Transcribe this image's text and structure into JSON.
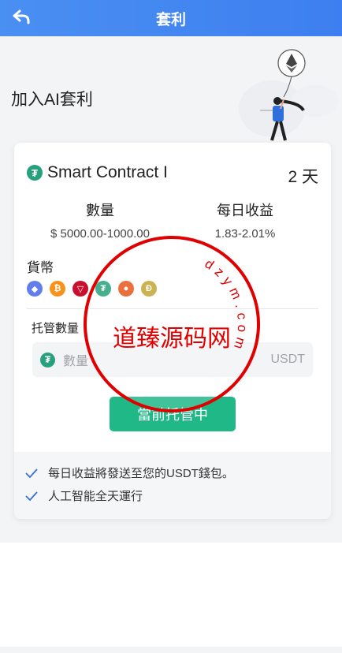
{
  "header": {
    "title": "套利",
    "back_icon": "back-arrow-icon"
  },
  "page": {
    "heading": "加入AI套利"
  },
  "card": {
    "coin_icon": "tether-icon",
    "contract_name": "Smart Contract I",
    "duration": "2 天",
    "stats": [
      {
        "label": "數量",
        "value": "$ 5000.00-1000.00"
      },
      {
        "label": "每日收益",
        "value": "1.83-2.01%"
      }
    ],
    "currency_label": "貨幣",
    "coins": [
      {
        "name": "ethereum-icon",
        "color": "#627eea",
        "glyph": "◆"
      },
      {
        "name": "bitcoin-icon",
        "color": "#f7931a",
        "glyph": "₿"
      },
      {
        "name": "tron-icon",
        "color": "#c8102e",
        "glyph": "▽"
      },
      {
        "name": "tether-icon",
        "color": "#26a17b",
        "glyph": "₮"
      },
      {
        "name": "shiba-icon",
        "color": "#e8581f",
        "glyph": "●"
      },
      {
        "name": "dogecoin-icon",
        "color": "#c2a633",
        "glyph": "Ð"
      }
    ],
    "deposit_label": "托管數量",
    "amount_placeholder": "數量",
    "amount_unit": "USDT",
    "submit_label": "當前托管中",
    "features": [
      "每日收益將發送至您的USDT錢包。",
      "人工智能全天運行"
    ]
  },
  "watermark": {
    "center_text": "道臻源码网",
    "ring_text": "dzym.com",
    "color": "#e00000"
  }
}
